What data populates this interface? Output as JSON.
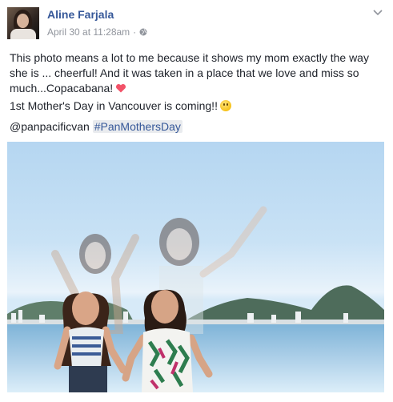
{
  "post": {
    "author_name": "Aline Farjala",
    "timestamp": "April 30 at 11:28am",
    "separator": "·",
    "privacy_icon": "globe-icon",
    "options_icon": "chevron-down-icon",
    "paragraph_1": "This photo means a lot to me because it shows my mom exactly the way she is ... cheerful! And it was taken in a place that we love and miss so much...Copacabana!",
    "paragraph_2": "1st Mother's Day in Vancouver is coming!!",
    "mention": "@panpacificvan",
    "hashtag": "#PanMothersDay",
    "emoji_heart": "heart-emoji",
    "emoji_smile": "smile-emoji"
  },
  "colors": {
    "link_blue": "#365899",
    "meta_gray": "#90949c",
    "text": "#1d2129",
    "hashtag_bg": "#e9ebee",
    "heart_red": "#f25268"
  }
}
